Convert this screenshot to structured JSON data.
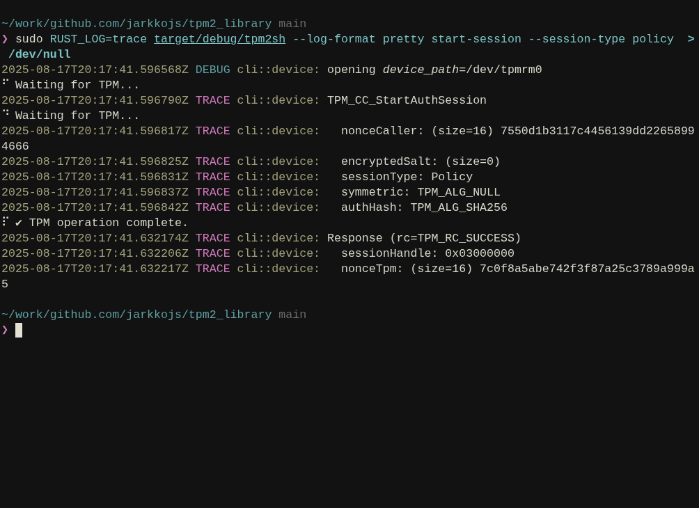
{
  "lines": [
    {
      "kind": "prompt",
      "path": "~/work/github.com/jarkkojs/tpm2_library",
      "branch": "main"
    },
    {
      "kind": "command",
      "symbol": "❯",
      "segments": [
        {
          "kind": "word",
          "text": "sudo"
        },
        {
          "kind": "env",
          "text": "RUST_LOG=trace"
        },
        {
          "kind": "path",
          "text": "target/debug/tpm2sh"
        },
        {
          "kind": "args",
          "text": "--log-format pretty start-session --session-type policy"
        },
        {
          "kind": "redirect",
          "text": ">"
        }
      ]
    },
    {
      "kind": "continuation",
      "segments": [
        {
          "kind": "target",
          "text": "/dev/null"
        }
      ]
    },
    {
      "kind": "log",
      "timestamp": "2025-08-17T20:17:41.596568Z",
      "level": {
        "text": "DEBUG",
        "color": "#5e9fa3"
      },
      "target": "cli::device:",
      "message": "opening *device_path*=/dev/tpmrm0"
    },
    {
      "kind": "progress",
      "spinner": "⠋",
      "text": "Waiting for TPM..."
    },
    {
      "kind": "log",
      "timestamp": "2025-08-17T20:17:41.596790Z",
      "level": {
        "text": "TRACE",
        "color": "#d27bbd"
      },
      "target": "cli::device:",
      "message": "TPM_CC_StartAuthSession"
    },
    {
      "kind": "progress",
      "spinner": "⠙",
      "text": "Waiting for TPM..."
    },
    {
      "kind": "log",
      "timestamp": "2025-08-17T20:17:41.596817Z",
      "level": {
        "text": "TRACE",
        "color": "#d27bbd"
      },
      "target": "cli::device:",
      "message": "  nonceCaller: (size=16) 7550d1b3117c4456139dd2265899"
    },
    {
      "kind": "wrap",
      "text": "4666"
    },
    {
      "kind": "log",
      "timestamp": "2025-08-17T20:17:41.596825Z",
      "level": {
        "text": "TRACE",
        "color": "#d27bbd"
      },
      "target": "cli::device:",
      "message": "  encryptedSalt: (size=0)"
    },
    {
      "kind": "log",
      "timestamp": "2025-08-17T20:17:41.596831Z",
      "level": {
        "text": "TRACE",
        "color": "#d27bbd"
      },
      "target": "cli::device:",
      "message": "  sessionType: Policy"
    },
    {
      "kind": "log",
      "timestamp": "2025-08-17T20:17:41.596837Z",
      "level": {
        "text": "TRACE",
        "color": "#d27bbd"
      },
      "target": "cli::device:",
      "message": "  symmetric: TPM_ALG_NULL"
    },
    {
      "kind": "log",
      "timestamp": "2025-08-17T20:17:41.596842Z",
      "level": {
        "text": "TRACE",
        "color": "#d27bbd"
      },
      "target": "cli::device:",
      "message": "  authHash: TPM_ALG_SHA256"
    },
    {
      "kind": "progress",
      "spinner": "⠏",
      "text": "✔ TPM operation complete."
    },
    {
      "kind": "log",
      "timestamp": "2025-08-17T20:17:41.632174Z",
      "level": {
        "text": "TRACE",
        "color": "#d27bbd"
      },
      "target": "cli::device:",
      "message": "Response (rc=TPM_RC_SUCCESS)"
    },
    {
      "kind": "log",
      "timestamp": "2025-08-17T20:17:41.632206Z",
      "level": {
        "text": "TRACE",
        "color": "#d27bbd"
      },
      "target": "cli::device:",
      "message": "  sessionHandle: 0x03000000"
    },
    {
      "kind": "log",
      "timestamp": "2025-08-17T20:17:41.632217Z",
      "level": {
        "text": "TRACE",
        "color": "#d27bbd"
      },
      "target": "cli::device:",
      "message": "  nonceTpm: (size=16) 7c0f8a5abe742f3f87a25c3789a999a"
    },
    {
      "kind": "wrap",
      "text": "5"
    },
    {
      "kind": "blank"
    },
    {
      "kind": "prompt",
      "path": "~/work/github.com/jarkkojs/tpm2_library",
      "branch": "main"
    },
    {
      "kind": "input",
      "symbol": "❯",
      "cursor": true
    }
  ]
}
